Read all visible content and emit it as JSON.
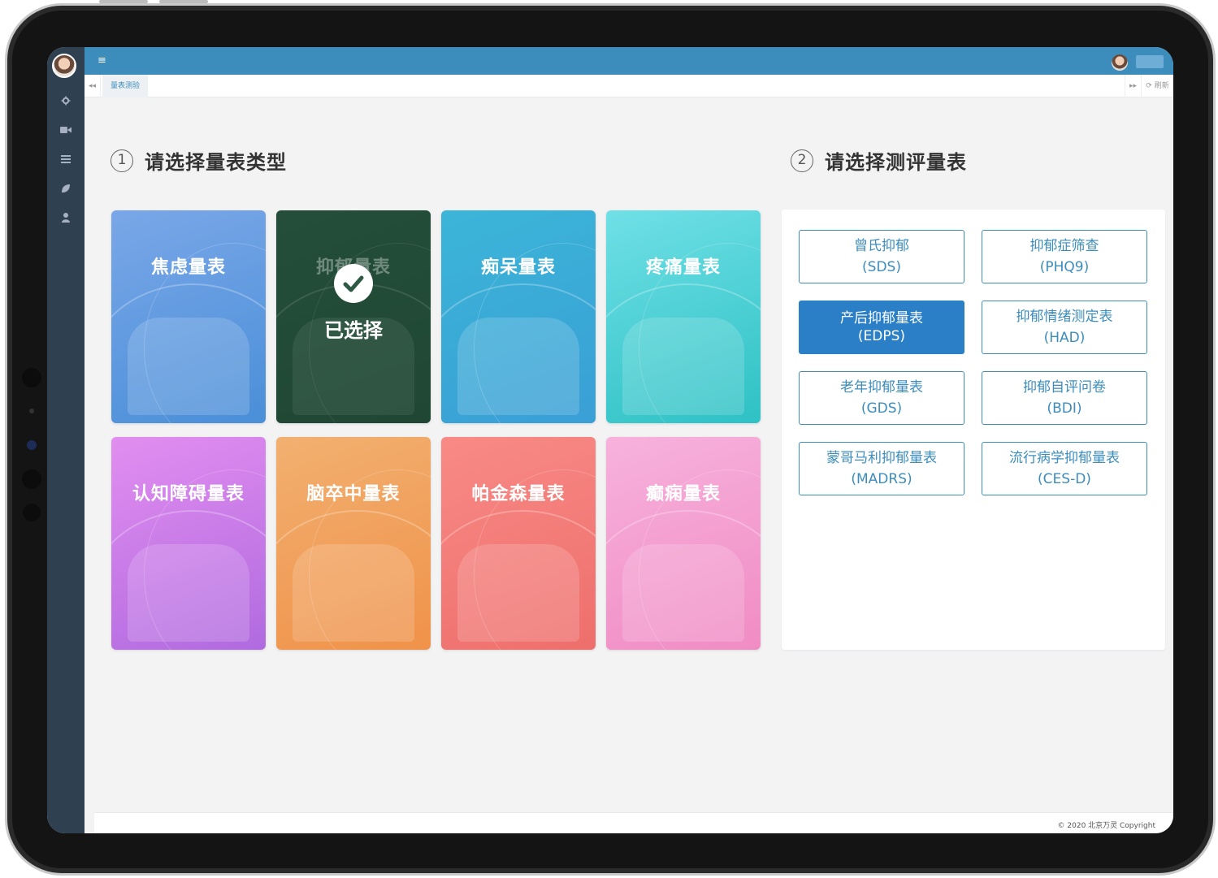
{
  "sidebar": {
    "icons": [
      "gear-icon",
      "video-icon",
      "list-icon",
      "leaf-icon",
      "user-icon"
    ]
  },
  "topbar": {
    "menu_glyph": "≡"
  },
  "tabs": {
    "prev_glyph": "◂◂",
    "active_tab": "量表测验",
    "next_glyph": "▸▸",
    "refresh_label": "⟳ 刷新"
  },
  "section1": {
    "number": "1",
    "title": "请选择量表类型"
  },
  "section2": {
    "number": "2",
    "title": "请选择测评量表"
  },
  "cards": [
    {
      "label": "焦虑量表",
      "color_top": "#7aa7e8",
      "color_bottom": "#4a8fd8"
    },
    {
      "label": "抑郁量表",
      "color_top": "#2e5a45",
      "color_bottom": "#234a38",
      "selected": true,
      "selected_text": "已选择"
    },
    {
      "label": "痴呆量表",
      "color_top": "#3bb5d8",
      "color_bottom": "#3a9fd6"
    },
    {
      "label": "疼痛量表",
      "color_top": "#6fe0e6",
      "color_bottom": "#2ec1c4"
    },
    {
      "label": "认知障碍量表",
      "color_top": "#e28ef0",
      "color_bottom": "#b06adf"
    },
    {
      "label": "脑卒中量表",
      "color_top": "#f2b070",
      "color_bottom": "#f0924a"
    },
    {
      "label": "帕金森量表",
      "color_top": "#f88a86",
      "color_bottom": "#ee6f6c"
    },
    {
      "label": "癫痫量表",
      "color_top": "#f7b2dc",
      "color_bottom": "#f08cc4"
    }
  ],
  "scales": [
    {
      "name": "曾氏抑郁",
      "code": "(SDS)"
    },
    {
      "name": "抑郁症筛查",
      "code": "(PHQ9)"
    },
    {
      "name": "产后抑郁量表",
      "code": "(EDPS)",
      "active": true
    },
    {
      "name": "抑郁情绪测定表",
      "code": "(HAD)"
    },
    {
      "name": "老年抑郁量表",
      "code": "(GDS)"
    },
    {
      "name": "抑郁自评问卷",
      "code": "(BDI)"
    },
    {
      "name": "蒙哥马利抑郁量表",
      "code": "(MADRS)"
    },
    {
      "name": "流行病学抑郁量表",
      "code": "(CES-D)"
    }
  ],
  "footer": {
    "copyright": "© 2020 北京万灵 Copyright"
  },
  "colors": {
    "accent": "#3c8dbc",
    "active_scale": "#2a7fc7",
    "sidebar": "#2f4050"
  }
}
